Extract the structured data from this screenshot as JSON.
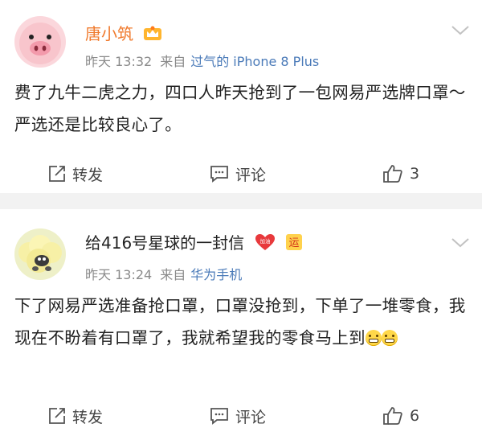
{
  "posts": [
    {
      "username": "唐小筑",
      "time": "昨天 13:32",
      "from_label": "来自",
      "source": "过气的 iPhone 8 Plus",
      "content": "费了九牛二虎之力，四口人昨天抢到了一包网易严选牌口罩～ 严选还是比较良心了。",
      "repost_label": "转发",
      "comment_label": "评论",
      "like_count": "3"
    },
    {
      "username": "给416号星球的一封信",
      "badge_text": "加油",
      "badge2_text": "运",
      "time": "昨天 13:24",
      "from_label": "来自",
      "source": "华为手机",
      "content": "下了网易严选准备抢口罩，口罩没抢到，下单了一堆零食，我现在不盼着有口罩了，我就希望我的零食马上到",
      "repost_label": "转发",
      "comment_label": "评论",
      "like_count": "6"
    }
  ],
  "colors": {
    "accent_name": "#f07a2d",
    "source_link": "#4a7ab8",
    "meta": "#8a8a8a",
    "divider": "#f2f2f2"
  }
}
